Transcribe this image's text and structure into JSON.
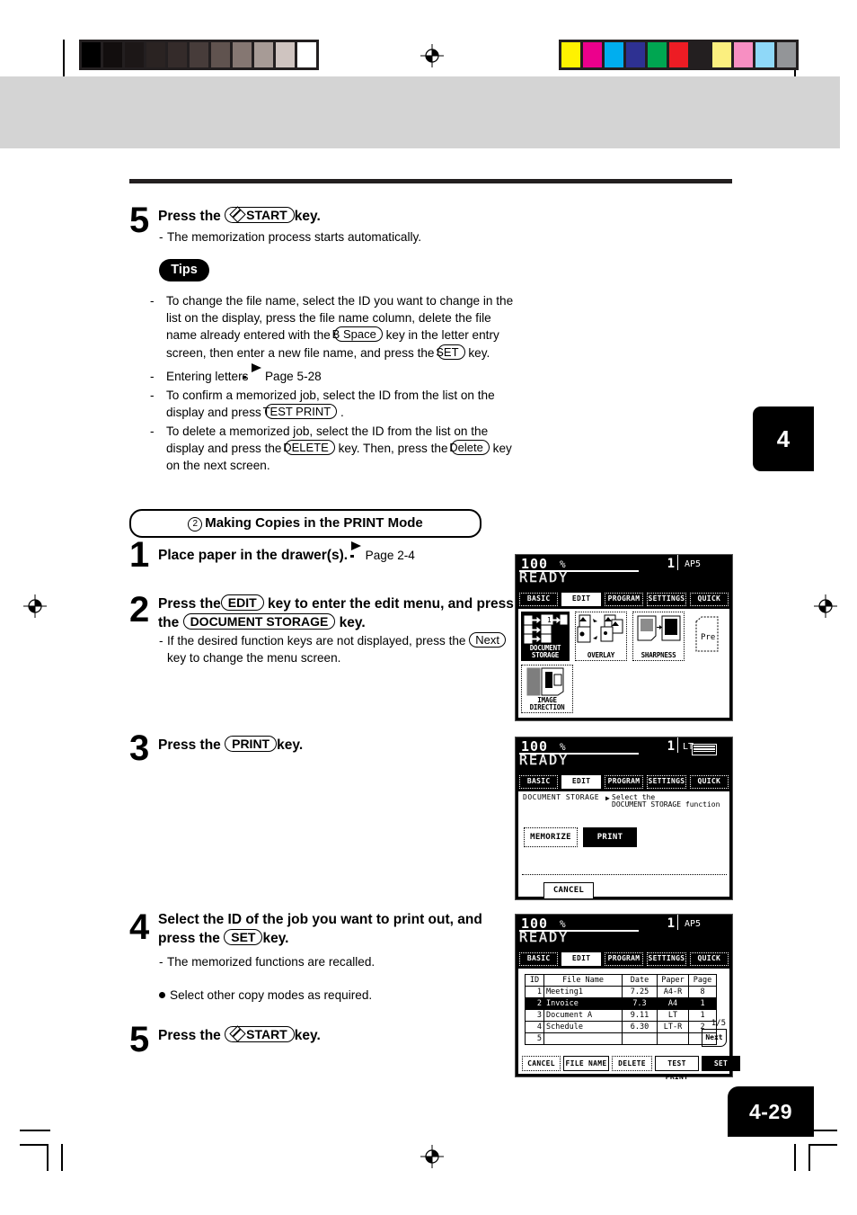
{
  "page": {
    "chapter_tab": "4",
    "page_number": "4-29"
  },
  "prod_marks": {
    "gray_wedge": [
      "#000000",
      "#120e0e",
      "#1c1717",
      "#2a2322",
      "#342b2a",
      "#473c3a",
      "#60534f",
      "#857772",
      "#a79b96",
      "#cfc4c0",
      "#ffffff"
    ],
    "color_bar": [
      "#fff200",
      "#ec008c",
      "#00aeef",
      "#2e3192",
      "#00a651",
      "#ed1c24",
      "#231f20",
      "#fbef7f",
      "#f островf",
      "#8fd8f8",
      "#939598"
    ],
    "color_bar_fixed": [
      "#fff200",
      "#ec008c",
      "#00aeef",
      "#2e3192",
      "#00a651",
      "#ed1c24",
      "#231f20",
      "#fbef7f",
      "#f78fc2",
      "#8fd8f8",
      "#939598"
    ]
  },
  "step5_top": {
    "number": "5",
    "title_pre": "Press the",
    "title_key": "START",
    "title_post": "key.",
    "note": "The memorization process starts automatically."
  },
  "tips": {
    "badge": "Tips",
    "items": [
      {
        "parts": [
          {
            "t": "text",
            "v": "To change the file name, select the ID you want to change in the list on the display, press the file name column, delete the file name already entered with the"
          },
          {
            "t": "key",
            "v": "B Space"
          },
          {
            "t": "text",
            "v": "key in the letter entry screen, then enter a new file name, and press the"
          },
          {
            "t": "key",
            "v": "SET"
          },
          {
            "t": "text",
            "v": "key."
          }
        ]
      },
      {
        "parts": [
          {
            "t": "text",
            "v": "Entering letters"
          },
          {
            "t": "arrow",
            "v": ""
          },
          {
            "t": "text",
            "v": "Page 5-28"
          }
        ]
      },
      {
        "parts": [
          {
            "t": "text",
            "v": "To confirm a memorized job, select the ID from the list on the display and press"
          },
          {
            "t": "key",
            "v": "TEST PRINT"
          },
          {
            "t": "text",
            "v": "."
          }
        ]
      },
      {
        "parts": [
          {
            "t": "text",
            "v": "To delete a memorized job, select the ID from the list on the display and press the"
          },
          {
            "t": "key",
            "v": "DELETE"
          },
          {
            "t": "text",
            "v": "key. Then, press the"
          },
          {
            "t": "key",
            "v": "Delete"
          },
          {
            "t": "text",
            "v": "key on the next screen."
          }
        ]
      }
    ]
  },
  "section": {
    "num": "2",
    "title": "Making Copies in the PRINT Mode"
  },
  "step1": {
    "number": "1",
    "title": "Place paper in the drawer(s).",
    "ref": "Page 2-4"
  },
  "step2": {
    "number": "2",
    "title_a": "Press the",
    "key_a": "EDIT",
    "title_b": "key to enter the edit menu, and press",
    "title_c": "the",
    "key_b": "DOCUMENT STORAGE",
    "title_d": "key.",
    "note_a": "If the desired function keys are not displayed, press the",
    "note_key": "Next",
    "note_b": "key to change the menu screen."
  },
  "step3": {
    "number": "3",
    "title_pre": "Press the",
    "title_key": "PRINT",
    "title_post": "key."
  },
  "step4": {
    "number": "4",
    "title_a": "Select the ID of the job you want to print out, and",
    "title_b": "press the",
    "key": "SET",
    "title_c": "key.",
    "note": "The memorized functions are recalled.",
    "bullet": "Select other copy modes as required."
  },
  "step5_bottom": {
    "number": "5",
    "title_pre": "Press the",
    "title_key": "START",
    "title_post": "key."
  },
  "lcd1": {
    "zoom": "100",
    "pct": "%",
    "copies": "1",
    "status": "READY",
    "paper": "AP5",
    "tabs": [
      {
        "label": "BASIC",
        "selected": false
      },
      {
        "label": "EDIT",
        "selected": true
      },
      {
        "label": "PROGRAM",
        "selected": false
      },
      {
        "label": "SETTINGS",
        "selected": false
      },
      {
        "label": "QUICK",
        "selected": false
      }
    ],
    "keys": [
      {
        "label": "DOCUMENT STORAGE",
        "selected": true
      },
      {
        "label": "OVERLAY",
        "selected": false
      },
      {
        "label": "SHARPNESS",
        "selected": false
      },
      {
        "label": "IMAGE DIRECTION",
        "selected": false
      }
    ],
    "page_peek": "Pre"
  },
  "lcd2": {
    "zoom": "100",
    "pct": "%",
    "copies": "1",
    "status": "READY",
    "paper": "LT",
    "breadcrumb": "DOCUMENT STORAGE",
    "prompt_a": "Select the",
    "prompt_b": "DOCUMENT STORAGE function",
    "tabs": [
      {
        "label": "BASIC",
        "selected": false
      },
      {
        "label": "EDIT",
        "selected": true
      },
      {
        "label": "PROGRAM",
        "selected": false
      },
      {
        "label": "SETTINGS",
        "selected": false
      },
      {
        "label": "QUICK",
        "selected": false
      }
    ],
    "memorize_label": "MEMORIZE",
    "print_label": "PRINT",
    "cancel_label": "CANCEL"
  },
  "lcd3": {
    "zoom": "100",
    "pct": "%",
    "copies": "1",
    "status": "READY",
    "paper": "AP5",
    "tabs": [
      {
        "label": "BASIC",
        "selected": false
      },
      {
        "label": "EDIT",
        "selected": true
      },
      {
        "label": "PROGRAM",
        "selected": false
      },
      {
        "label": "SETTINGS",
        "selected": false
      },
      {
        "label": "QUICK",
        "selected": false
      }
    ],
    "table": {
      "headers": [
        "ID",
        "File Name",
        "Date",
        "Paper",
        "Page"
      ],
      "rows": [
        {
          "id": "1",
          "name": "Meeting1",
          "date": "7.25",
          "paper": "A4-R",
          "page": "8",
          "selected": false
        },
        {
          "id": "2",
          "name": "Invoice",
          "date": "7.3",
          "paper": "A4",
          "page": "1",
          "selected": true
        },
        {
          "id": "3",
          "name": "Document A",
          "date": "9.11",
          "paper": "LT",
          "page": "1",
          "selected": false
        },
        {
          "id": "4",
          "name": "Schedule",
          "date": "6.30",
          "paper": "LT-R",
          "page": "2",
          "selected": false
        },
        {
          "id": "5",
          "name": "",
          "date": "",
          "paper": "",
          "page": "",
          "selected": false
        }
      ]
    },
    "page_indicator": "1/5",
    "next_label": "Next",
    "buttons": [
      "CANCEL",
      "FILE NAME",
      "DELETE",
      "TEST PRINT",
      "SET"
    ],
    "button_selected": "SET"
  }
}
